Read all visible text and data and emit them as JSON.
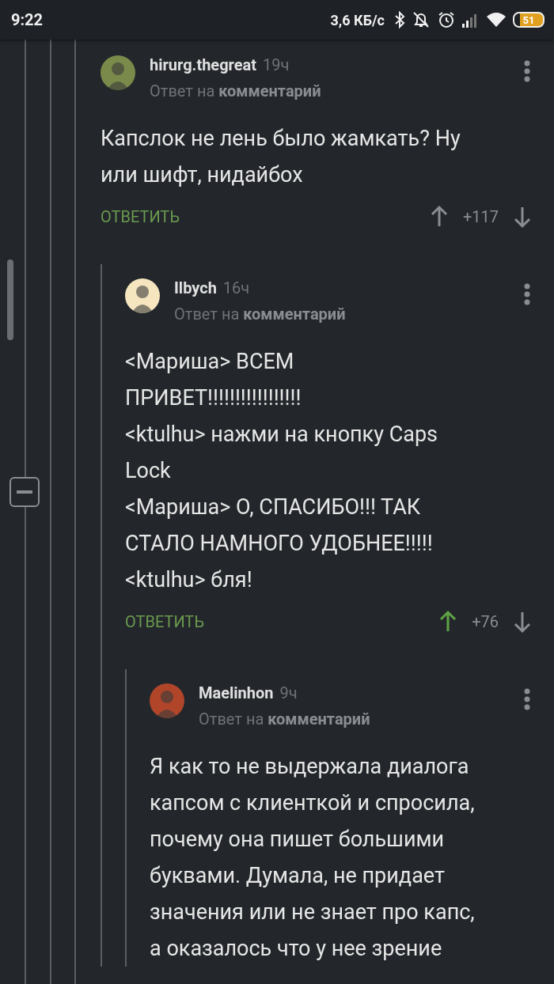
{
  "status_bar": {
    "time": "9:22",
    "speed": "3,6 КБ/с",
    "battery": "51"
  },
  "comments": [
    {
      "user": "hirurg.thegreat",
      "time": "19ч",
      "reply_to": "Ответ на **комментарий**",
      "lines": [
        "Капслок не лень было жамкать? Ну",
        "или шифт, нидайбох"
      ],
      "reply": "ОТВЕТИТЬ",
      "score": "+117",
      "upvoted": false,
      "children": [
        {
          "user": "Ilbych",
          "time": "16ч",
          "reply_to": "Ответ на **комментарий**",
          "lines": [
            "<Мариша> ВСЕМ",
            "ПРИВЕТ!!!!!!!!!!!!!!!!!",
            "<ktulhu> нажми на кнопку Caps",
            "Lock",
            "<Мариша> О, СПАСИБО!!! ТАК",
            "СТАЛО НАМНОГО УДОБНЕЕ!!!!!",
            "<ktulhu> бля!"
          ],
          "reply": "ОТВЕТИТЬ",
          "score": "+76",
          "upvoted": true,
          "children": [
            {
              "user": "Maelinhon",
              "time": "9ч",
              "reply_to": "Ответ на **комментарий**",
              "lines": [
                "Я как то не выдержала диалога",
                "капсом с клиенткой и спросила,",
                "почему она пишет большими",
                "буквами. Думала, не придает",
                "значения или не знает про капс,",
                "а оказалось что у нее зрение"
              ]
            }
          ]
        }
      ]
    }
  ]
}
